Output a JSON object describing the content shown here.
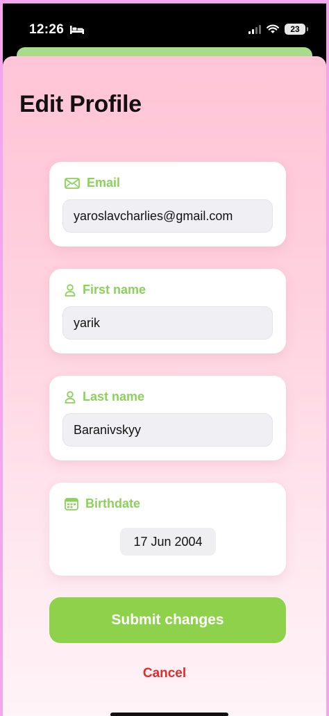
{
  "status_bar": {
    "time": "12:26",
    "battery": "23",
    "icons": [
      "bed-icon",
      "signal-icon",
      "wifi-icon",
      "battery-icon"
    ]
  },
  "page": {
    "title": "Edit Profile"
  },
  "form": {
    "email": {
      "label": "Email",
      "value": "yaroslavcharlies@gmail.com",
      "icon": "envelope-icon"
    },
    "first_name": {
      "label": "First name",
      "value": "yarik",
      "icon": "person-icon"
    },
    "last_name": {
      "label": "Last name",
      "value": "Baranivskyy",
      "icon": "person-icon"
    },
    "birthdate": {
      "label": "Birthdate",
      "value": "17 Jun 2004",
      "icon": "calendar-icon"
    }
  },
  "actions": {
    "submit_label": "Submit changes",
    "cancel_label": "Cancel"
  },
  "colors": {
    "accent_green": "#8ed14a",
    "label_green": "#8cd15a",
    "cancel_red": "#e02b2b",
    "background_pink": "#ffc4d7"
  }
}
